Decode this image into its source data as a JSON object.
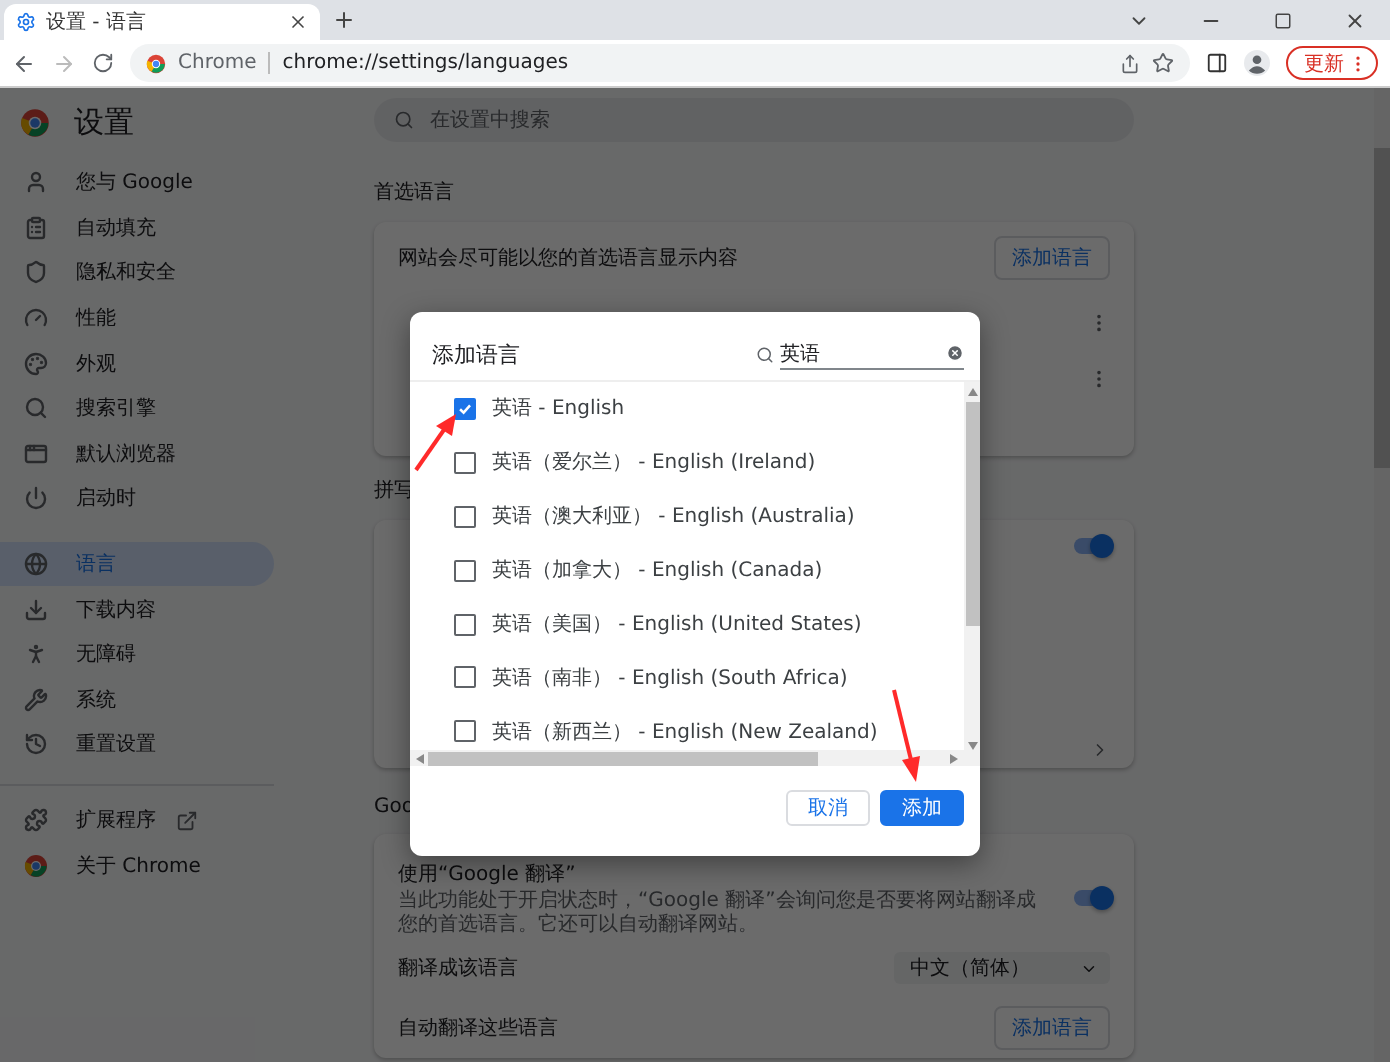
{
  "browser": {
    "tabs": [
      {
        "title": "设置 - 语言",
        "selected": true
      }
    ],
    "omnibox": {
      "chip": "Chrome",
      "url": "chrome://settings/languages"
    },
    "update_button": "更新"
  },
  "sidebar": {
    "title": "设置",
    "items": [
      {
        "label": "您与 Google",
        "selected": false
      },
      {
        "label": "自动填充",
        "selected": false
      },
      {
        "label": "隐私和安全",
        "selected": false
      },
      {
        "label": "性能",
        "selected": false
      },
      {
        "label": "外观",
        "selected": false
      },
      {
        "label": "搜索引擎",
        "selected": false
      },
      {
        "label": "默认浏览器",
        "selected": false
      },
      {
        "label": "启动时",
        "selected": false
      },
      {
        "label": "语言",
        "selected": true
      },
      {
        "label": "下载内容",
        "selected": false
      },
      {
        "label": "无障碍",
        "selected": false
      },
      {
        "label": "系统",
        "selected": false
      },
      {
        "label": "重置设置",
        "selected": false
      }
    ],
    "footer_items": [
      {
        "label": "扩展程序"
      },
      {
        "label": "关于 Chrome"
      }
    ]
  },
  "search": {
    "placeholder": "在设置中搜索"
  },
  "preferred_languages": {
    "heading": "首选语言",
    "description": "网站会尽可能以您的首选语言显示内容",
    "add_button": "添加语言"
  },
  "spelling": {
    "heading": "拼写",
    "toggle_on": true
  },
  "translate": {
    "heading": "Goo",
    "title": "使用“Google 翻译”",
    "description": "当此功能处于开启状态时，“Google 翻译”会询问您是否要将网站翻译成您的首选语言。它还可以自动翻译网站。",
    "toggle_on": true,
    "target_label": "翻译成该语言",
    "target_value": "中文（简体）",
    "auto_label": "自动翻译这些语言",
    "auto_button": "添加语言"
  },
  "dialog": {
    "title": "添加语言",
    "search_value": "英语",
    "languages": [
      {
        "label": "英语 - English",
        "checked": true
      },
      {
        "label": "英语（爱尔兰） - English (Ireland)",
        "checked": false
      },
      {
        "label": "英语（澳大利亚） - English (Australia)",
        "checked": false
      },
      {
        "label": "英语（加拿大） - English (Canada)",
        "checked": false
      },
      {
        "label": "英语（美国） - English (United States)",
        "checked": false
      },
      {
        "label": "英语（南非） - English (South Africa)",
        "checked": false
      },
      {
        "label": "英语（新西兰） - English (New Zealand)",
        "checked": false
      }
    ],
    "cancel_button": "取消",
    "confirm_button": "添加"
  }
}
